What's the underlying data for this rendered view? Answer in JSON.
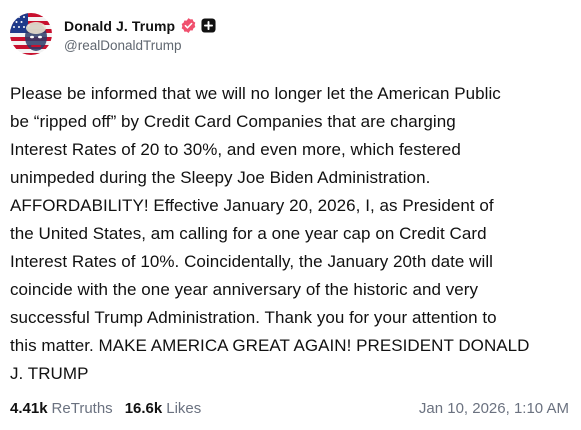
{
  "author": {
    "display_name": "Donald J. Trump",
    "handle": "@realDonaldTrump",
    "avatar_icon": "avatar-flag-portrait",
    "verified_icon": "verified-badge-icon",
    "verified_color": "#f0506e",
    "plus_icon": "plus-square-icon"
  },
  "post": {
    "text": "Please be informed that we will no longer let the American Public\nbe “ripped off” by Credit Card Companies that are charging\nInterest Rates of 20 to 30%, and even more, which festered\nunimpeded during the Sleepy Joe Biden Administration.\nAFFORDABILITY! Effective January 20, 2026, I, as President of\nthe United States, am calling for a one year cap on Credit Card\nInterest Rates of 10%. Coincidentally, the January 20th date will\ncoincide with the one year anniversary of the historic and very\nsuccessful Trump Administration. Thank you for your attention to\nthis matter. MAKE AMERICA GREAT AGAIN! PRESIDENT DONALD\nJ. TRUMP"
  },
  "stats": {
    "retruths_count": "4.41k",
    "retruths_label": "ReTruths",
    "likes_count": "16.6k",
    "likes_label": "Likes"
  },
  "timestamp": "Jan 10, 2026, 1:10 AM"
}
